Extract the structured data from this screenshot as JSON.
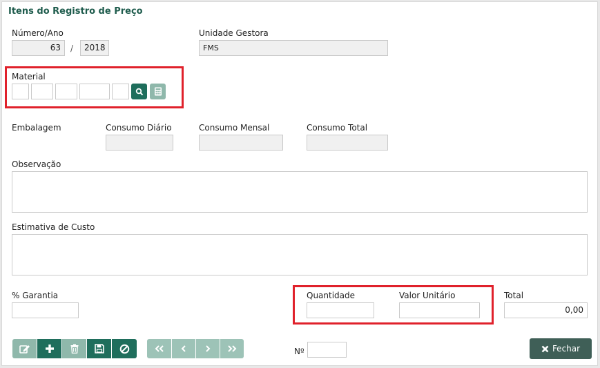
{
  "panel": {
    "title": "Itens do Registro de Preço"
  },
  "numero_ano": {
    "label": "Número/Ano",
    "numero": "63",
    "separator": "/",
    "ano": "2018"
  },
  "unidade_gestora": {
    "label": "Unidade Gestora",
    "value": "FMS"
  },
  "material": {
    "label": "Material",
    "fields": [
      "",
      "",
      "",
      "",
      ""
    ],
    "search_icon": "search-icon",
    "calculator_icon": "calculator-icon"
  },
  "embalagem": {
    "label": "Embalagem"
  },
  "consumo_diario": {
    "label": "Consumo Diário",
    "value": ""
  },
  "consumo_mensal": {
    "label": "Consumo Mensal",
    "value": ""
  },
  "consumo_total": {
    "label": "Consumo Total",
    "value": ""
  },
  "observacao": {
    "label": "Observação",
    "value": ""
  },
  "estimativa": {
    "label": "Estimativa de Custo",
    "value": ""
  },
  "garantia": {
    "label": "% Garantia",
    "value": ""
  },
  "quantidade": {
    "label": "Quantidade",
    "value": ""
  },
  "valor_unitario": {
    "label": "Valor Unitário",
    "value": ""
  },
  "total": {
    "label": "Total",
    "value": "0,00"
  },
  "numero": {
    "label": "Nº",
    "value": ""
  },
  "toolbar": {
    "icons": [
      "edit-icon",
      "plus-icon",
      "trash-icon",
      "save-icon",
      "cancel-icon"
    ],
    "nav_icons": [
      "first-icon",
      "prev-icon",
      "next-icon",
      "last-icon"
    ]
  },
  "fechar": {
    "label": "Fechar"
  },
  "colors": {
    "dark_green": "#1f6e5c",
    "light_green": "#8fb8ab",
    "nav_green": "#9dc3b7",
    "fechar_bg": "#3f5f57",
    "title": "#1f5c4d",
    "highlight_red": "#e0212b"
  }
}
